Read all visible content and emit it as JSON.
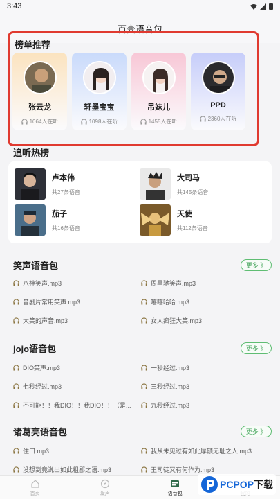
{
  "status_bar": {
    "time": "3:43"
  },
  "page": {
    "title": "百变语音包"
  },
  "recommend": {
    "title": "榜单推荐",
    "cards": [
      {
        "name": "张云龙",
        "count": "1064人在听",
        "bg": "#fbe3bf"
      },
      {
        "name": "轩墨宝宝",
        "count": "1098人在听",
        "bg": "#c9dafb"
      },
      {
        "name": "吊妹儿",
        "count": "1455人在听",
        "bg": "#f8c7d6"
      },
      {
        "name": "PPD",
        "count": "2360人在听",
        "bg": "#c6cdfa"
      }
    ]
  },
  "hot": {
    "title": "追听热榜",
    "items": [
      {
        "name": "卢本伟",
        "sub": "共27条语音"
      },
      {
        "name": "大司马",
        "sub": "共145条语音"
      },
      {
        "name": "茄子",
        "sub": "共16条语音"
      },
      {
        "name": "天使",
        "sub": "共112条语音"
      }
    ]
  },
  "packs": [
    {
      "title": "笑声语音包",
      "more": "更多 》",
      "sounds": [
        "八神笑声.mp3",
        "周星驰笑声.mp3",
        "音剧片常用笑声.mp3",
        "嘻嘻哈哈.mp3",
        "大笑的声音.mp3",
        "女人疯狂大笑.mp3"
      ]
    },
    {
      "title": "jojo语音包",
      "more": "更多 》",
      "sounds": [
        "DIO笑声.mp3",
        "一秒经过.mp3",
        "七秒经过.mp3",
        "三秒经过.mp3",
        "不可能！！我DIO！！我DIO！！（是...",
        "九秒经过.mp3"
      ]
    },
    {
      "title": "诸葛亮语音包",
      "more": "更多 》",
      "sounds": [
        "住口.mp3",
        "我从未见过有如此厚颜无耻之人.mp3",
        "没想到竟说出如此粗鄙之语.mp3",
        "王司徒又有何作为.mp3"
      ]
    }
  ],
  "nav": {
    "items": [
      {
        "label": "首页"
      },
      {
        "label": "发声"
      },
      {
        "label": "语音包"
      },
      {
        "label": "我的"
      }
    ]
  },
  "watermark": {
    "text_p": "PCPOP",
    "text_cn": "下载"
  }
}
